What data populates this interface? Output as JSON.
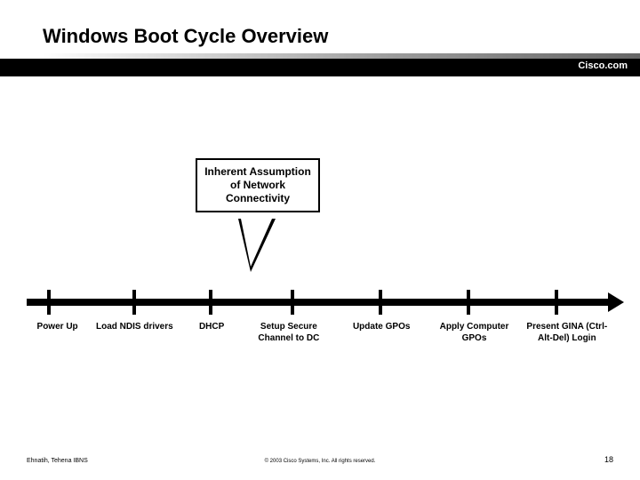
{
  "header": {
    "title": "Windows Boot Cycle Overview",
    "brand": "Cisco.com"
  },
  "callout": {
    "text": "Inherent Assumption of Network Connectivity"
  },
  "timeline": {
    "steps": [
      "Power Up",
      "Load NDIS drivers",
      "DHCP",
      "Setup Secure Channel to DC",
      "Update GPOs",
      "Apply Computer GPOs",
      "Present GINA (Ctrl-Alt-Del) Login"
    ]
  },
  "footer": {
    "left": "Ehnatih, Tehena IBNS",
    "center": "© 2003 Cisco Systems, Inc. All rights reserved.",
    "page": "18"
  },
  "colors": {
    "accent": "#000000",
    "bg": "#ffffff"
  }
}
